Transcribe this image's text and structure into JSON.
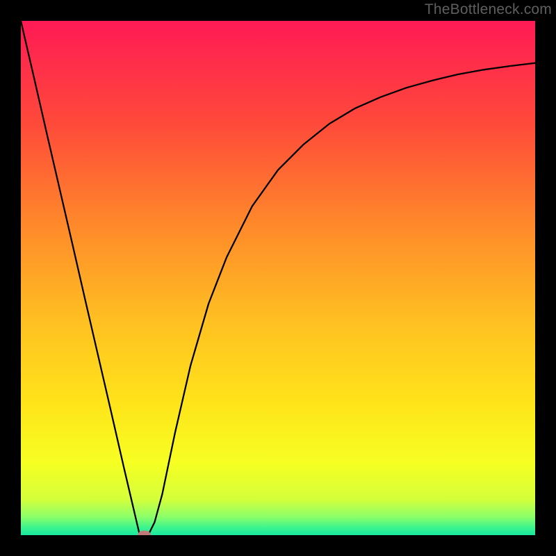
{
  "watermark": "TheBottleneck.com",
  "chart_data": {
    "type": "line",
    "title": "",
    "xlabel": "",
    "ylabel": "",
    "xlim": [
      0,
      100
    ],
    "ylim": [
      0,
      100
    ],
    "grid": false,
    "legend": false,
    "background_gradient": {
      "stops": [
        {
          "offset": 0.0,
          "color": "#ff1a55"
        },
        {
          "offset": 0.2,
          "color": "#ff4a3a"
        },
        {
          "offset": 0.4,
          "color": "#ff8a2a"
        },
        {
          "offset": 0.58,
          "color": "#ffbf22"
        },
        {
          "offset": 0.74,
          "color": "#ffe31a"
        },
        {
          "offset": 0.86,
          "color": "#f6ff22"
        },
        {
          "offset": 0.93,
          "color": "#d4ff3a"
        },
        {
          "offset": 0.965,
          "color": "#8aff6a"
        },
        {
          "offset": 0.985,
          "color": "#3cf58e"
        },
        {
          "offset": 1.0,
          "color": "#18e8a0"
        }
      ]
    },
    "series": [
      {
        "name": "curve",
        "type": "line",
        "color": "#000000",
        "width": 2,
        "x": [
          0.0,
          2.5,
          5.0,
          7.5,
          10.0,
          12.5,
          15.0,
          17.5,
          20.0,
          21.5,
          23.0,
          24.0,
          25.0,
          26.0,
          27.5,
          30.0,
          33.0,
          36.5,
          40.0,
          45.0,
          50.0,
          55.0,
          60.0,
          65.0,
          70.0,
          75.0,
          80.0,
          85.0,
          90.0,
          95.0,
          100.0
        ],
        "y": [
          100.0,
          89.2,
          78.3,
          67.5,
          56.7,
          45.8,
          35.0,
          24.2,
          13.3,
          6.9,
          0.5,
          0.0,
          0.5,
          2.5,
          8.0,
          20.0,
          33.0,
          45.0,
          54.0,
          64.0,
          71.0,
          76.0,
          80.0,
          83.0,
          85.2,
          87.0,
          88.4,
          89.6,
          90.5,
          91.2,
          91.8
        ]
      }
    ],
    "marker": {
      "x": 24.0,
      "y": 0.0,
      "rx": 1.3,
      "ry": 0.9,
      "color": "#c07b78"
    }
  }
}
